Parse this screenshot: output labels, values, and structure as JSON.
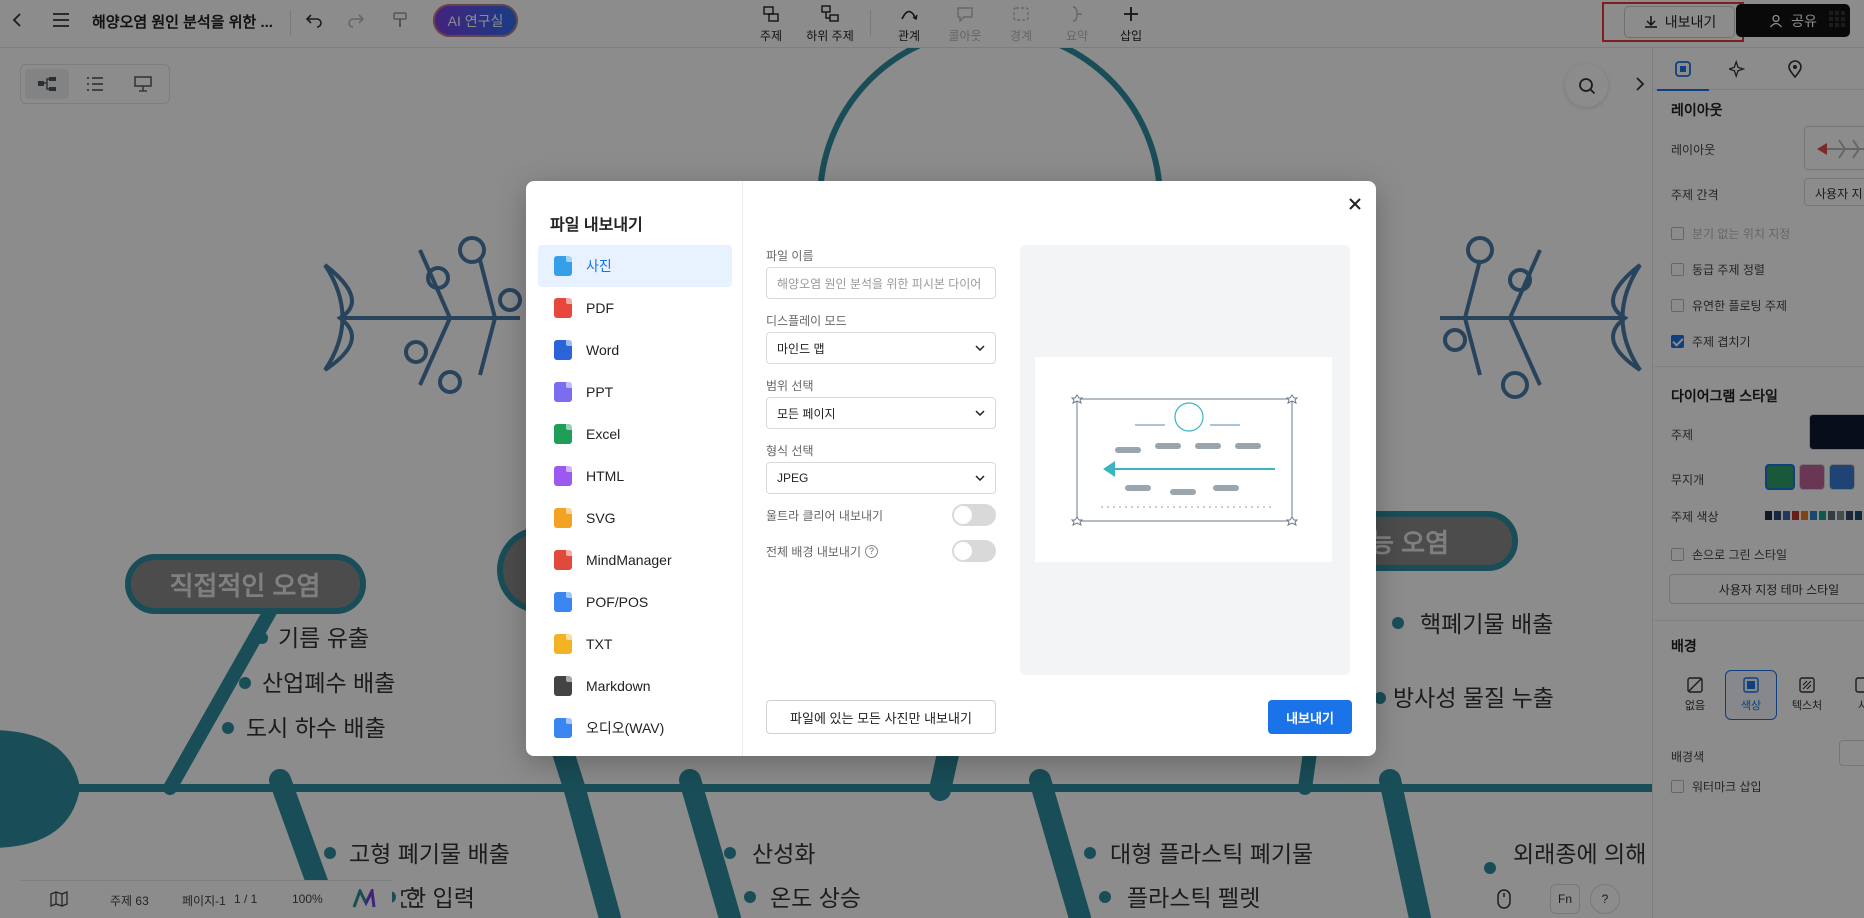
{
  "header": {
    "doc_title": "해양오염 원인 분석을 위한 ...",
    "ai_button": "AI 연구실",
    "tools": [
      {
        "label": "주제"
      },
      {
        "label": "하위 주제"
      },
      {
        "label": "관계"
      },
      {
        "label": "콜아웃"
      },
      {
        "label": "경계"
      },
      {
        "label": "요약"
      },
      {
        "label": "삽입"
      }
    ],
    "export_label": "내보내기",
    "share_label": "공유"
  },
  "diagram": {
    "left_title": "직접적인 오염",
    "right_title": "능 오염",
    "left_branches": [
      "기름 유출",
      "산업폐수 배출",
      "도시 하수 배출"
    ],
    "right_branches": [
      "핵폐기물 배출",
      "방사성 물질 누출"
    ],
    "bottom_branches": [
      "고형 폐기물 배출",
      "한 입력",
      "산성화",
      "온도 상승",
      "대형 플라스틱 폐기물",
      "플라스틱 펠렛",
      "외래종에 의해"
    ]
  },
  "right_panel": {
    "tabs": [
      "style-icon",
      "ai-icon",
      "pin-icon"
    ],
    "layout_section": "레이아웃",
    "layout_label": "레이아웃",
    "topic_spacing_label": "주제 간격",
    "topic_spacing_value": "사용자 지",
    "checks": [
      {
        "label": "분기 없는 위치 지정",
        "checked": false,
        "disabled": true
      },
      {
        "label": "동급 주제 정렬",
        "checked": false
      },
      {
        "label": "유연한 플로팅 주제",
        "checked": false
      },
      {
        "label": "주제 겹치기",
        "checked": true
      }
    ],
    "style_section": "다이어그램 스타일",
    "topic_label": "주제",
    "rainbow_label": "무지개",
    "topic_color_label": "주제 색상",
    "hand_drawn_label": "손으로 그린 스타일",
    "custom_theme_button": "사용자 지정 테마 스타일",
    "background_section": "배경",
    "bg_options": [
      {
        "label": "없음"
      },
      {
        "label": "색상"
      },
      {
        "label": "텍스처"
      },
      {
        "label": "사"
      }
    ],
    "bg_color_label": "배경색",
    "watermark_label": "워터마크 삽입",
    "swatch_colors": [
      "#1f2a44",
      "#2d4a7a",
      "#3d6aa8",
      "#c0392b",
      "#e67e22",
      "#2e86c1",
      "#17a589",
      "#5d6d7e",
      "#7f8c8d",
      "#34495e",
      "#1b4f72",
      "#0e6655"
    ]
  },
  "bottom_bar": {
    "topic_count": "주제 63",
    "page": "페이지-1",
    "page_num": "1 / 1",
    "zoom": "100%"
  },
  "export_dialog": {
    "title": "파일 내보내기",
    "formats": [
      {
        "label": "사진",
        "color": "#35a0e8"
      },
      {
        "label": "PDF",
        "color": "#e8473b"
      },
      {
        "label": "Word",
        "color": "#2b63d9"
      },
      {
        "label": "PPT",
        "color": "#7b6cf0"
      },
      {
        "label": "Excel",
        "color": "#1e9e56"
      },
      {
        "label": "HTML",
        "color": "#9b59f0"
      },
      {
        "label": "SVG",
        "color": "#f2a324"
      },
      {
        "label": "MindManager",
        "color": "#e04a3c"
      },
      {
        "label": "POF/POS",
        "color": "#3a86f0"
      },
      {
        "label": "TXT",
        "color": "#f2b324"
      },
      {
        "label": "Markdown",
        "color": "#444444"
      },
      {
        "label": "오디오(WAV)",
        "color": "#3a86f0"
      }
    ],
    "active_format": "사진",
    "file_name_label": "파일 이름",
    "file_name_placeholder": "해양오염 원인 분석을 위한 피시본 다이어",
    "display_mode_label": "디스플레이 모드",
    "display_mode_value": "마인드 맵",
    "range_label": "범위 선택",
    "range_value": "모든 페이지",
    "format_label": "형식 선택",
    "format_value": "JPEG",
    "ultra_clear_label": "울트라 클리어 내보내기",
    "full_bg_label": "전체 배경 내보내기",
    "export_images_button": "파일에 있는 모든 사진만 내보내기",
    "export_button": "내보내기"
  }
}
